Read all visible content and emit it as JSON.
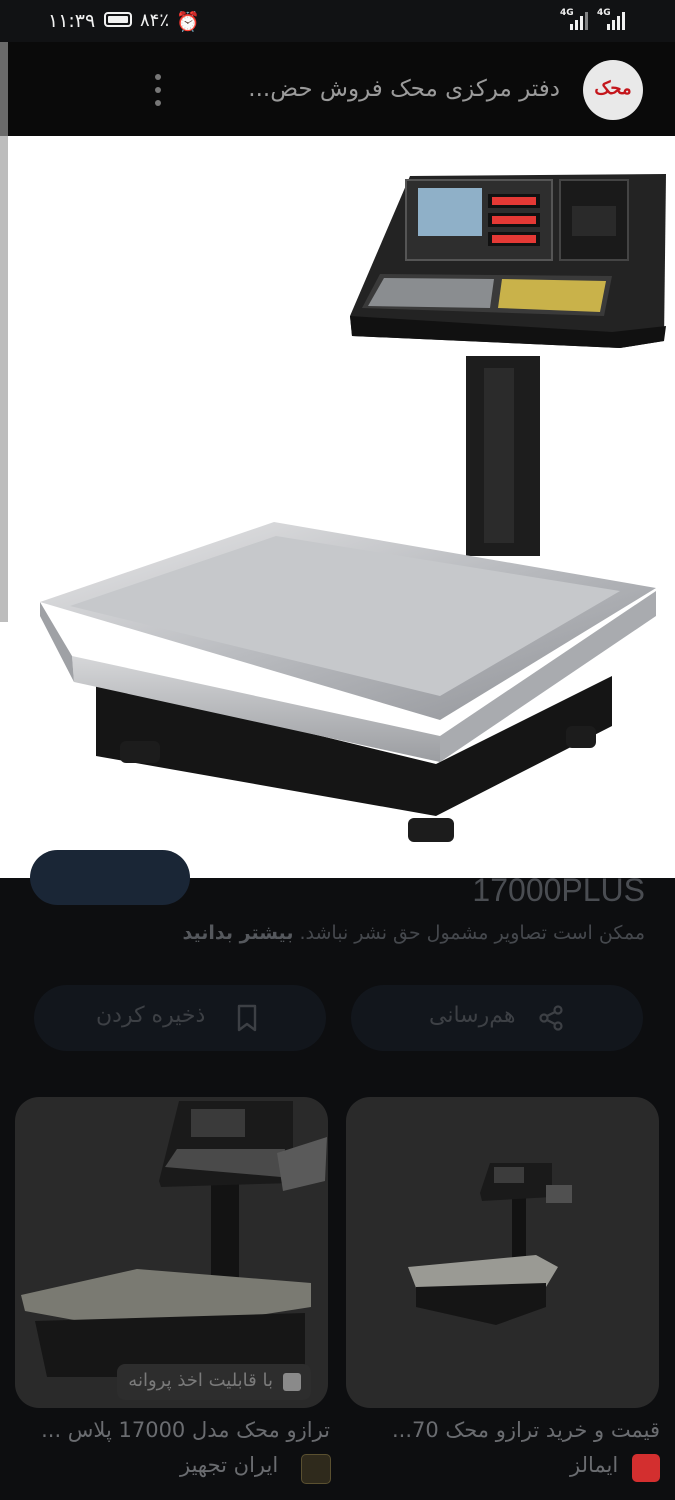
{
  "status_bar": {
    "time": "۱۱:۳۹",
    "battery": "۸۴٪",
    "network_1": "4G",
    "network_2": "4G"
  },
  "app_bar": {
    "site_logo_text": "محک",
    "title": "دفتر مرکزی محک فروش حض...",
    "menu_icon": "more-vert-icon"
  },
  "main_image": {
    "subject": "scale"
  },
  "detail": {
    "model": "17000PLUS",
    "copyright_notice": "ممکن است تصاویر مشمول حق نشر نباشد.",
    "learn_more": "بیشتر بدانید",
    "share_label": "هم‌رسانی",
    "save_label": "ذخیره کردن"
  },
  "results": [
    {
      "title": "قیمت و خرید ترازو محک 70...",
      "source": "ایمالز"
    },
    {
      "title": "ترازو محک مدل 17000 پلاس ...",
      "source": "ایران تجهیز",
      "badge": "با قابلیت اخذ پروانه"
    }
  ],
  "colors": {
    "background": "#0d0e10",
    "appbar": "#0a0a0a",
    "accent_red": "#c4161c",
    "source_icon_red": "#d32f2f"
  }
}
